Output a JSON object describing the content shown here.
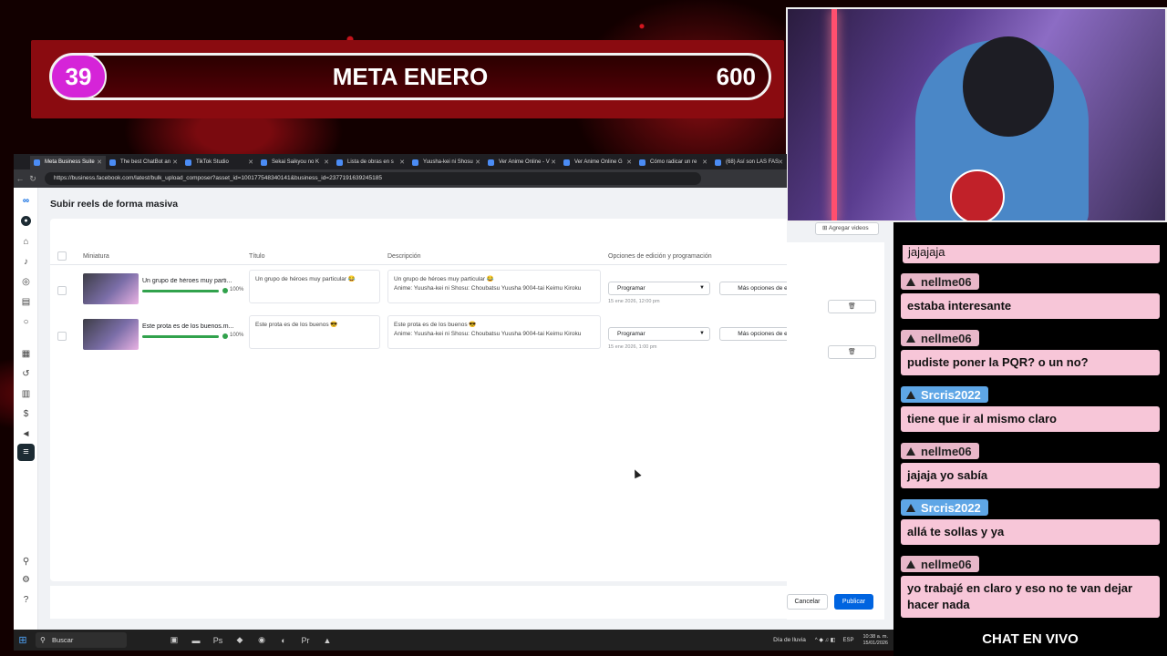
{
  "goal": {
    "count": "39",
    "title": "META ENERO",
    "target": "600"
  },
  "browser": {
    "tabs": [
      "Meta Business Suite",
      "The best ChatBot an",
      "TikTok Studio",
      "Sekai Saikyou no K",
      "Lista de obras en s",
      "Yuusha-kei ni Shosu",
      "Ver Anime Online - V",
      "Ver Anime Online G",
      "Cómo radicar un re",
      "(68) Así son LAS FAS"
    ],
    "url": "https://business.facebook.com/latest/bulk_upload_composer?asset_id=100177548340141&business_id=2377191639245185"
  },
  "app": {
    "title": "Subir reels de forma masiva",
    "add_video": "Agregar videos",
    "headers": {
      "thumb": "Miniatura",
      "title": "Título",
      "description": "Descripción",
      "options": "Opciones de edición y programación"
    },
    "rows": [
      {
        "name": "Un grupo de héroes muy parti...",
        "progress": 100,
        "pct": "100%",
        "title": "Un grupo de héroes muy particular 😂",
        "desc1": "Un grupo de héroes muy particular 😂",
        "desc2": "Anime: Yuusha-kei ni Shosu: Choubatsu Yuusha 9004-tai Keimu Kiroku",
        "schedule": "Programar",
        "date": "15 ene 2026, 12:00 pm",
        "more": "Más opciones de edición"
      },
      {
        "name": "Este prota es de los buenos.m...",
        "progress": 100,
        "pct": "100%",
        "title": "Este prota es de los buenos 😎",
        "desc1": "Este prota es de los buenos 😎",
        "desc2": "Anime: Yuusha-kei ni Shosu: Choubatsu Yuusha 9004-tai Keimu Kiroku",
        "schedule": "Programar",
        "date": "15 ene 2026, 1:00 pm",
        "more": "Más opciones de edición"
      }
    ],
    "cancel": "Cancelar",
    "publish": "Publicar"
  },
  "chat": {
    "top": "jajajaja",
    "messages": [
      {
        "user": "nellme06",
        "text": "estaba interesante",
        "style": "pink"
      },
      {
        "user": "nellme06",
        "text": "pudiste poner la PQR? o un no?",
        "style": "pink"
      },
      {
        "user": "Srcris2022",
        "text": "tiene que ir al mismo claro",
        "style": "blue"
      },
      {
        "user": "nellme06",
        "text": "jajaja yo sabía",
        "style": "pink"
      },
      {
        "user": "Srcris2022",
        "text": "allá te sollas y ya",
        "style": "blue"
      },
      {
        "user": "nellme06",
        "text": "yo trabajé en claro y eso no te van dejar hacer nada",
        "style": "pink"
      }
    ],
    "footer": "CHAT EN VIVO"
  },
  "taskbar": {
    "search": "Buscar",
    "weather": "Día de lluvia",
    "lang": "ESP",
    "time": "10:38 a. m.",
    "date": "15/01/2026"
  }
}
